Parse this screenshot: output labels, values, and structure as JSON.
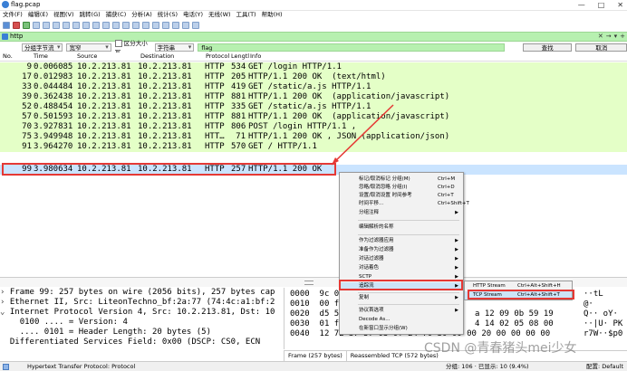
{
  "window": {
    "title": "flag.pcap",
    "controls": [
      "—",
      "□",
      "✕"
    ]
  },
  "menu": [
    "文件(F)",
    "编辑(E)",
    "视图(V)",
    "跳转(G)",
    "捕获(C)",
    "分析(A)",
    "统计(S)",
    "电话(Y)",
    "无线(W)",
    "工具(T)",
    "帮助(H)"
  ],
  "filter": {
    "value": "http",
    "right_controls": [
      "✕",
      "→",
      "▾",
      "+"
    ]
  },
  "search": {
    "scope": "分组字节流",
    "charset": "宽窄",
    "case_label": "区分大小写",
    "type": "字符串",
    "value": "flag",
    "find_label": "查找",
    "cancel_label": "取消"
  },
  "packet_list": {
    "columns": [
      "No.",
      "Time",
      "Source",
      "Destination",
      "Protocol",
      "Lengtl",
      "Info"
    ],
    "rows": [
      {
        "no": "9",
        "time": "0.006085",
        "src": "10.2.213.81",
        "dst": "10.2.213.81",
        "proto": "HTTP",
        "len": "534",
        "info": "GET /login HTTP/1.1"
      },
      {
        "no": "17",
        "time": "0.012983",
        "src": "10.2.213.81",
        "dst": "10.2.213.81",
        "proto": "HTTP",
        "len": "205",
        "info": "HTTP/1.1 200 OK  (text/html)"
      },
      {
        "no": "33",
        "time": "0.044484",
        "src": "10.2.213.81",
        "dst": "10.2.213.81",
        "proto": "HTTP",
        "len": "419",
        "info": "GET /static/a.js HTTP/1.1"
      },
      {
        "no": "39",
        "time": "0.362438",
        "src": "10.2.213.81",
        "dst": "10.2.213.81",
        "proto": "HTTP",
        "len": "881",
        "info": "HTTP/1.1 200 OK  (application/javascript)"
      },
      {
        "no": "52",
        "time": "0.488454",
        "src": "10.2.213.81",
        "dst": "10.2.213.81",
        "proto": "HTTP",
        "len": "335",
        "info": "GET /static/a.js HTTP/1.1"
      },
      {
        "no": "57",
        "time": "0.501593",
        "src": "10.2.213.81",
        "dst": "10.2.213.81",
        "proto": "HTTP",
        "len": "881",
        "info": "HTTP/1.1 200 OK  (application/javascript)"
      },
      {
        "no": "70",
        "time": "3.927831",
        "src": "10.2.213.81",
        "dst": "10.2.213.81",
        "proto": "HTTP",
        "len": "806",
        "info": "POST /login HTTP/1.1 ,"
      },
      {
        "no": "75",
        "time": "3.949948",
        "src": "10.2.213.81",
        "dst": "10.2.213.81",
        "proto": "HTT…",
        "len": "71",
        "info": "HTTP/1.1 200 OK , JSON (application/json)"
      },
      {
        "no": "91",
        "time": "3.964270",
        "src": "10.2.213.81",
        "dst": "10.2.213.81",
        "proto": "HTTP",
        "len": "570",
        "info": "GET / HTTP/1.1"
      },
      {
        "no": "99",
        "time": "3.980634",
        "src": "10.2.213.81",
        "dst": "10.2.213.81",
        "proto": "HTTP",
        "len": "257",
        "info": "HTTP/1.1 200 OK"
      }
    ]
  },
  "detail": [
    {
      "prefix": "› ",
      "text": "Frame 99: 257 bytes on wire (2056 bits), 257 bytes cap"
    },
    {
      "prefix": "› ",
      "text": "Ethernet II, Src: LiteonTechno_bf:2a:77 (74:4c:a1:bf:2"
    },
    {
      "prefix": "⌄ ",
      "text": "Internet Protocol Version 4, Src: 10.2.213.81, Dst: 10"
    },
    {
      "prefix": "    ",
      "text": "0100 .... = Version: 4"
    },
    {
      "prefix": "    ",
      "text": ".... 0101 = Header Length: 20 bytes (5)"
    },
    {
      "prefix": "  ",
      "text": "Differentiated Services Field: 0x00 (DSCP: CS0, ECN"
    }
  ],
  "bytes": [
    {
      "offset": "0000",
      "hex": "9c 0",
      "ascii": "··tL"
    },
    {
      "offset": "0010",
      "hex": "00 f3",
      "ascii": "@·"
    },
    {
      "offset": "0020",
      "hex": "d5 51",
      "hex_right": "a 12 09 0b 59 19",
      "ascii": "Q·· oY·"
    },
    {
      "offset": "0030",
      "hex": "01 ff",
      "hex_right": "4 14 02 05 08 00",
      "ascii": "··|U· PK"
    },
    {
      "offset": "0040",
      "hex": "12 72 37 57 03 0f 24 70 30 00 00 20 00 00 00 00",
      "ascii": "r7W··$p0"
    }
  ],
  "bytes_tabs": [
    "Frame (257 bytes)",
    "Reassembled TCP (572 bytes)"
  ],
  "context_menu": {
    "items": [
      {
        "label": "标记/取消标记 分组(M)",
        "shortcut": "Ctrl+M"
      },
      {
        "label": "忽略/取消忽略 分组(I)",
        "shortcut": "Ctrl+D"
      },
      {
        "label": "设置/取消设置 时间参考",
        "shortcut": "Ctrl+T"
      },
      {
        "label": "时间平移...",
        "shortcut": "Ctrl+Shift+T"
      },
      {
        "label": "分组注释",
        "submenu": true
      },
      {
        "label": "编辑解析的名称"
      },
      {
        "label": "作为过滤器应用",
        "submenu": true
      },
      {
        "label": "准备作为过滤器",
        "submenu": true
      },
      {
        "label": "对话过滤器",
        "submenu": true
      },
      {
        "label": "对话着色",
        "submenu": true
      },
      {
        "label": "SCTP",
        "submenu": true
      },
      {
        "label": "追踪流",
        "submenu": true
      },
      {
        "label": "复制",
        "submenu": true
      },
      {
        "label": "协议首选项",
        "submenu": true
      },
      {
        "label": "Decode As..."
      },
      {
        "label": "在新窗口显示分组(W)"
      }
    ],
    "follow_submenu": [
      {
        "label": "HTTP Stream",
        "shortcut": "Ctrl+Alt+Shift+H"
      },
      {
        "label": "TCP Stream",
        "shortcut": "Ctrl+Alt+Shift+T"
      }
    ]
  },
  "status": {
    "text": "Hypertext Transfer Protocol: Protocol",
    "packets": "分组: 106 · 已显示: 10 (9.4%)",
    "profile": "配置: Default"
  },
  "watermark": "CSDN @青春猪头mei少女",
  "colors": {
    "http_row": "#e4ffc7",
    "selected_row": "#cae4ff",
    "filter_bg": "#b7f0b0",
    "highlight": "#e53935"
  }
}
